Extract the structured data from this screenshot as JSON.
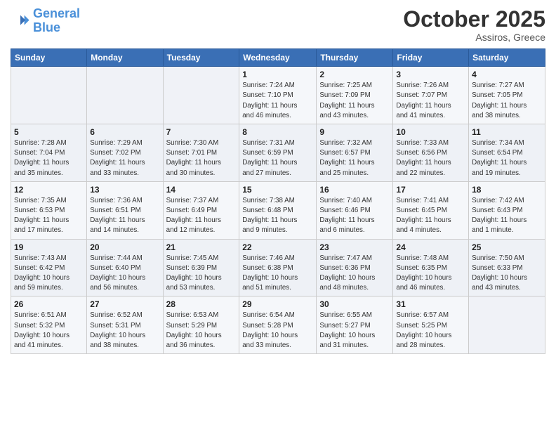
{
  "header": {
    "logo_line1": "General",
    "logo_line2": "Blue",
    "month": "October 2025",
    "location": "Assiros, Greece"
  },
  "weekdays": [
    "Sunday",
    "Monday",
    "Tuesday",
    "Wednesday",
    "Thursday",
    "Friday",
    "Saturday"
  ],
  "weeks": [
    [
      {
        "day": "",
        "info": ""
      },
      {
        "day": "",
        "info": ""
      },
      {
        "day": "",
        "info": ""
      },
      {
        "day": "1",
        "info": "Sunrise: 7:24 AM\nSunset: 7:10 PM\nDaylight: 11 hours\nand 46 minutes."
      },
      {
        "day": "2",
        "info": "Sunrise: 7:25 AM\nSunset: 7:09 PM\nDaylight: 11 hours\nand 43 minutes."
      },
      {
        "day": "3",
        "info": "Sunrise: 7:26 AM\nSunset: 7:07 PM\nDaylight: 11 hours\nand 41 minutes."
      },
      {
        "day": "4",
        "info": "Sunrise: 7:27 AM\nSunset: 7:05 PM\nDaylight: 11 hours\nand 38 minutes."
      }
    ],
    [
      {
        "day": "5",
        "info": "Sunrise: 7:28 AM\nSunset: 7:04 PM\nDaylight: 11 hours\nand 35 minutes."
      },
      {
        "day": "6",
        "info": "Sunrise: 7:29 AM\nSunset: 7:02 PM\nDaylight: 11 hours\nand 33 minutes."
      },
      {
        "day": "7",
        "info": "Sunrise: 7:30 AM\nSunset: 7:01 PM\nDaylight: 11 hours\nand 30 minutes."
      },
      {
        "day": "8",
        "info": "Sunrise: 7:31 AM\nSunset: 6:59 PM\nDaylight: 11 hours\nand 27 minutes."
      },
      {
        "day": "9",
        "info": "Sunrise: 7:32 AM\nSunset: 6:57 PM\nDaylight: 11 hours\nand 25 minutes."
      },
      {
        "day": "10",
        "info": "Sunrise: 7:33 AM\nSunset: 6:56 PM\nDaylight: 11 hours\nand 22 minutes."
      },
      {
        "day": "11",
        "info": "Sunrise: 7:34 AM\nSunset: 6:54 PM\nDaylight: 11 hours\nand 19 minutes."
      }
    ],
    [
      {
        "day": "12",
        "info": "Sunrise: 7:35 AM\nSunset: 6:53 PM\nDaylight: 11 hours\nand 17 minutes."
      },
      {
        "day": "13",
        "info": "Sunrise: 7:36 AM\nSunset: 6:51 PM\nDaylight: 11 hours\nand 14 minutes."
      },
      {
        "day": "14",
        "info": "Sunrise: 7:37 AM\nSunset: 6:49 PM\nDaylight: 11 hours\nand 12 minutes."
      },
      {
        "day": "15",
        "info": "Sunrise: 7:38 AM\nSunset: 6:48 PM\nDaylight: 11 hours\nand 9 minutes."
      },
      {
        "day": "16",
        "info": "Sunrise: 7:40 AM\nSunset: 6:46 PM\nDaylight: 11 hours\nand 6 minutes."
      },
      {
        "day": "17",
        "info": "Sunrise: 7:41 AM\nSunset: 6:45 PM\nDaylight: 11 hours\nand 4 minutes."
      },
      {
        "day": "18",
        "info": "Sunrise: 7:42 AM\nSunset: 6:43 PM\nDaylight: 11 hours\nand 1 minute."
      }
    ],
    [
      {
        "day": "19",
        "info": "Sunrise: 7:43 AM\nSunset: 6:42 PM\nDaylight: 10 hours\nand 59 minutes."
      },
      {
        "day": "20",
        "info": "Sunrise: 7:44 AM\nSunset: 6:40 PM\nDaylight: 10 hours\nand 56 minutes."
      },
      {
        "day": "21",
        "info": "Sunrise: 7:45 AM\nSunset: 6:39 PM\nDaylight: 10 hours\nand 53 minutes."
      },
      {
        "day": "22",
        "info": "Sunrise: 7:46 AM\nSunset: 6:38 PM\nDaylight: 10 hours\nand 51 minutes."
      },
      {
        "day": "23",
        "info": "Sunrise: 7:47 AM\nSunset: 6:36 PM\nDaylight: 10 hours\nand 48 minutes."
      },
      {
        "day": "24",
        "info": "Sunrise: 7:48 AM\nSunset: 6:35 PM\nDaylight: 10 hours\nand 46 minutes."
      },
      {
        "day": "25",
        "info": "Sunrise: 7:50 AM\nSunset: 6:33 PM\nDaylight: 10 hours\nand 43 minutes."
      }
    ],
    [
      {
        "day": "26",
        "info": "Sunrise: 6:51 AM\nSunset: 5:32 PM\nDaylight: 10 hours\nand 41 minutes."
      },
      {
        "day": "27",
        "info": "Sunrise: 6:52 AM\nSunset: 5:31 PM\nDaylight: 10 hours\nand 38 minutes."
      },
      {
        "day": "28",
        "info": "Sunrise: 6:53 AM\nSunset: 5:29 PM\nDaylight: 10 hours\nand 36 minutes."
      },
      {
        "day": "29",
        "info": "Sunrise: 6:54 AM\nSunset: 5:28 PM\nDaylight: 10 hours\nand 33 minutes."
      },
      {
        "day": "30",
        "info": "Sunrise: 6:55 AM\nSunset: 5:27 PM\nDaylight: 10 hours\nand 31 minutes."
      },
      {
        "day": "31",
        "info": "Sunrise: 6:57 AM\nSunset: 5:25 PM\nDaylight: 10 hours\nand 28 minutes."
      },
      {
        "day": "",
        "info": ""
      }
    ]
  ]
}
